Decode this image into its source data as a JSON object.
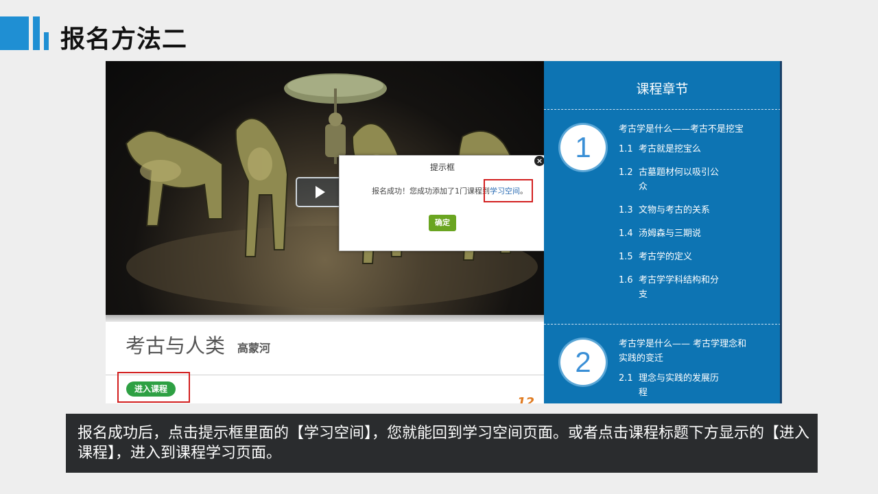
{
  "slide": {
    "title": "报名方法二",
    "caption": "报名成功后，点击提示框里面的【学习空间】，您就能回到学习空间页面。或者点击课程标题下方显示的【进入课程】，进入到课程学习页面。"
  },
  "course": {
    "title": "考古与人类",
    "teacher": "高蒙河",
    "enter_button": "进入课程",
    "partial_number": "12"
  },
  "dialog": {
    "title": "提示框",
    "message_prefix": "报名成功！您成功添加了1门课程到",
    "link_text": "学习空间",
    "message_suffix": "。",
    "ok_button": "确定",
    "close_glyph": "×"
  },
  "chapters": {
    "header": "课程章节",
    "groups": [
      {
        "number": "1",
        "title": "考古学是什么——考古不是挖宝",
        "items": [
          {
            "num": "1.1",
            "text": "考古就是挖宝么"
          },
          {
            "num": "1.2",
            "text": "古墓题材何以吸引公",
            "cont": "众"
          },
          {
            "num": "1.3",
            "text": "文物与考古的关系"
          },
          {
            "num": "1.4",
            "text": "汤姆森与三期说"
          },
          {
            "num": "1.5",
            "text": "考古学的定义"
          },
          {
            "num": "1.6",
            "text": "考古学学科结构和分",
            "cont": "支"
          }
        ]
      },
      {
        "number": "2",
        "title": "考古学是什么—— 考古学理念和",
        "title_cont": "实践的变迁",
        "items": [
          {
            "num": "2.1",
            "text": "理念与实践的发展历",
            "cont": "程"
          }
        ]
      }
    ]
  },
  "colors": {
    "accent_blue": "#1f8fd3",
    "panel_blue": "#0d74b3",
    "enter_green": "#2ea043",
    "ok_green": "#6aa521",
    "highlight_red": "#d21e1e",
    "caption_bg": "#2a2c2e"
  }
}
